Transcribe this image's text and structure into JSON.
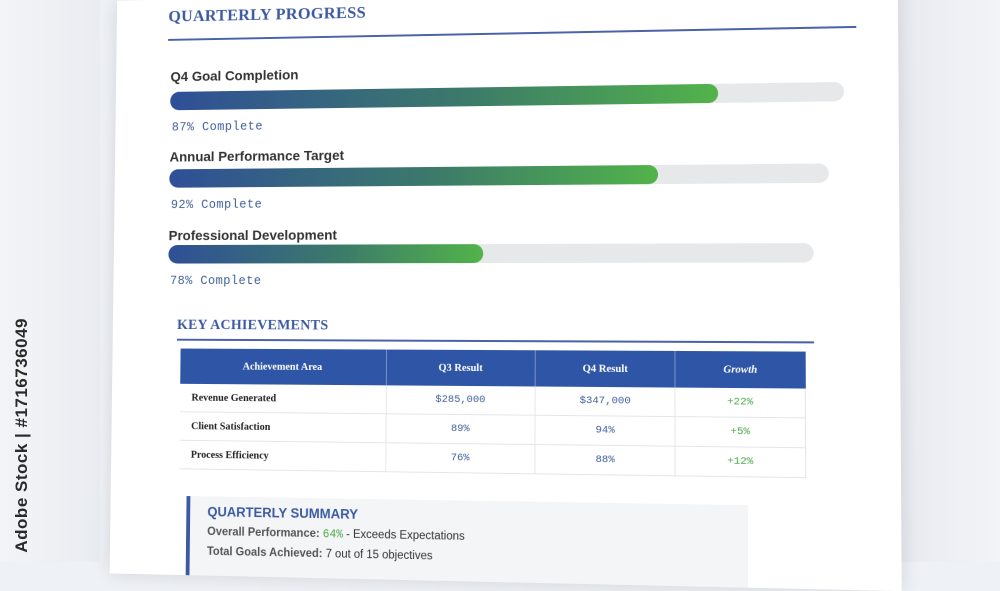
{
  "header": {
    "title": "QUARTERLY PROGRESS"
  },
  "goals": [
    {
      "label": "Q4 Goal Completion",
      "progress": 0.82,
      "status": "87% Complete"
    },
    {
      "label": "Annual Performance Target",
      "progress": 0.75,
      "status": "92% Complete"
    },
    {
      "label": "Professional Development",
      "progress": 0.5,
      "status": "78% Complete"
    }
  ],
  "achievements": {
    "title": "KEY ACHIEVEMENTS",
    "columns": [
      "Achievement Area",
      "Q3 Result",
      "Q4 Result",
      "Growth"
    ],
    "rows": [
      [
        "Revenue Generated",
        "$285,000",
        "$347,000",
        "+22%"
      ],
      [
        "Client Satisfaction",
        "89%",
        "94%",
        "+5%"
      ],
      [
        "Process Efficiency",
        "76%",
        "88%",
        "+12%"
      ]
    ]
  },
  "summary": {
    "title": "QUARTERLY SUMMARY",
    "overall_label": "Overall Performance:",
    "overall_value": "64%",
    "overall_note": "- Exceeds Expectations",
    "goals_label": "Total Goals Achieved:",
    "goals_value": "7 out of 15 objectives"
  },
  "credit": {
    "text": "Adobe Stock | #1716736049"
  },
  "colors": {
    "accent": "#3b5aa1",
    "bar_start": "#2f4f97",
    "bar_end": "#52b34a",
    "growth": "#4aa84a"
  }
}
